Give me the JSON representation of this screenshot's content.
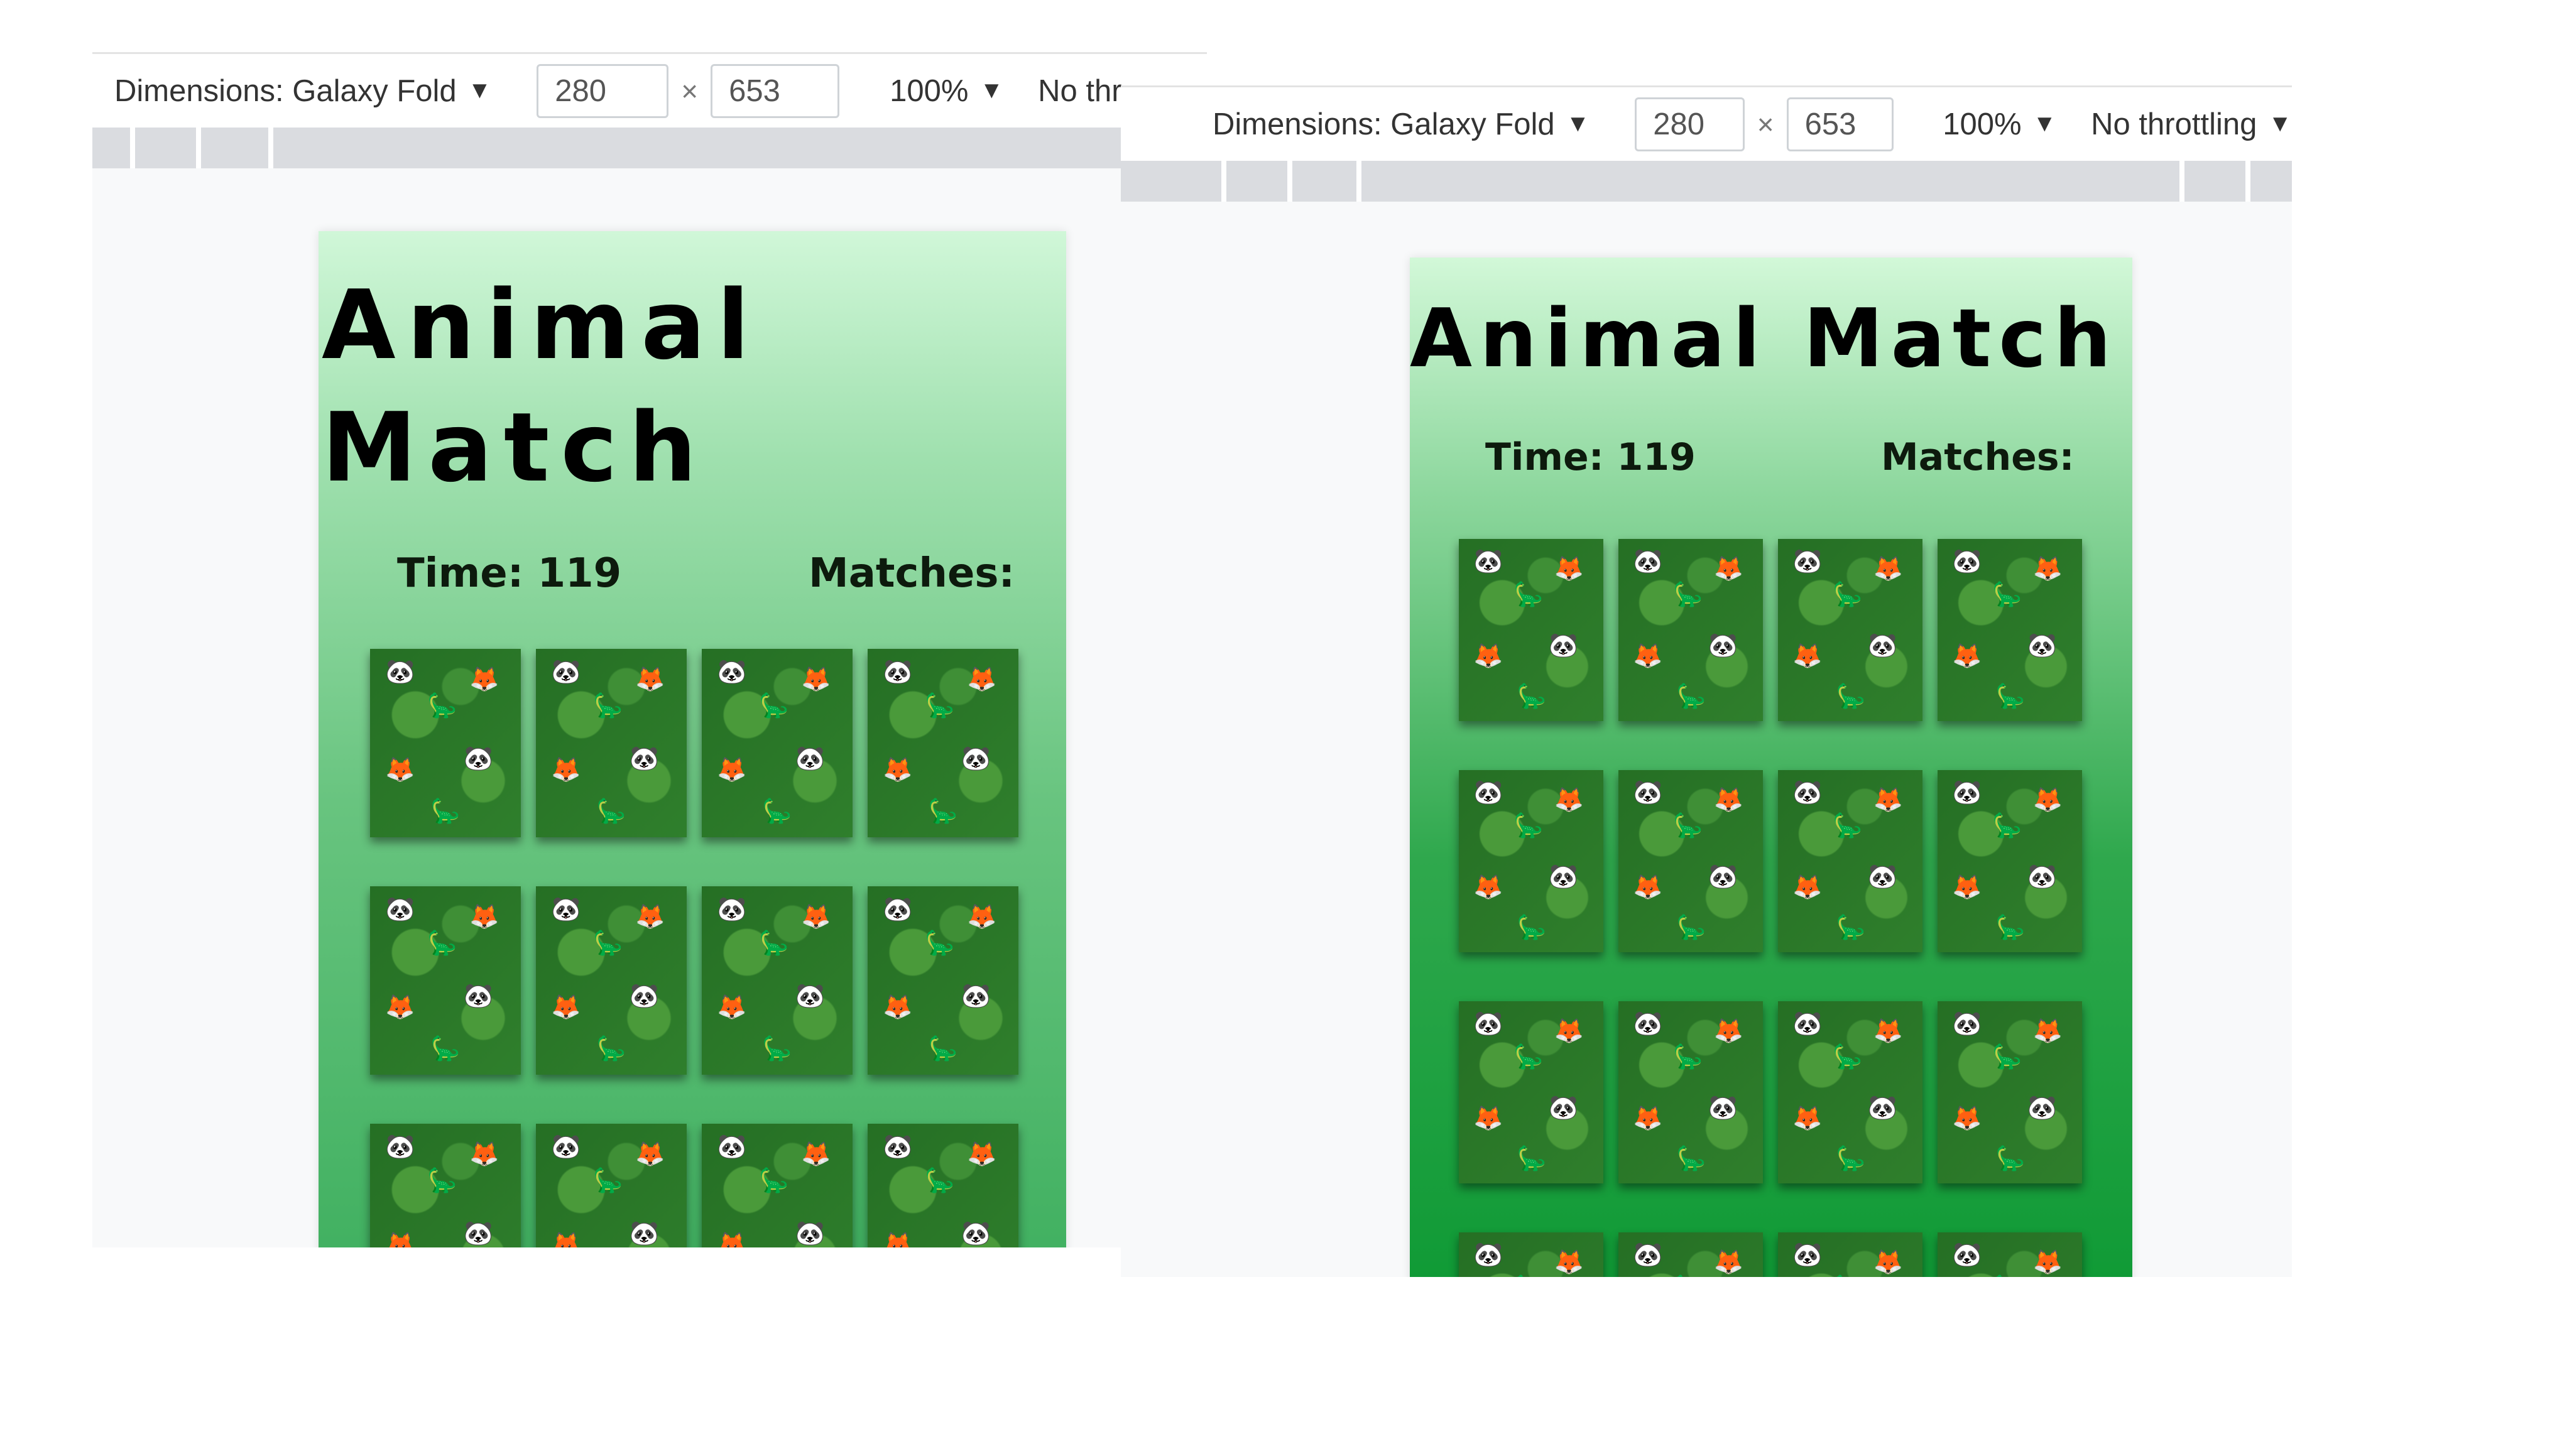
{
  "devtools": {
    "left": {
      "dimensions_label": "Dimensions: Galaxy Fold",
      "width_value": "280",
      "height_value": "653",
      "times_sign": "×",
      "zoom": "100%",
      "throttling": "No thr"
    },
    "right": {
      "dimensions_label": "Dimensions: Galaxy Fold",
      "width_value": "280",
      "height_value": "653",
      "times_sign": "×",
      "zoom": "100%",
      "throttling": "No throttling"
    }
  },
  "game": {
    "title": "Animal Match",
    "time_label": "Time: 119",
    "matches_label": "Matches:"
  },
  "cards": {
    "animal_glyphs": [
      "🐼",
      "🦕",
      "🦊",
      "🦊",
      "🐼",
      "🦕"
    ],
    "left_count": 12,
    "right_count": 16
  },
  "icons": {
    "dropdown": "dropdown-arrow-icon"
  },
  "colors": {
    "card_back": "#2f7f2c",
    "game_green": "#40b060",
    "text": "#000000"
  }
}
